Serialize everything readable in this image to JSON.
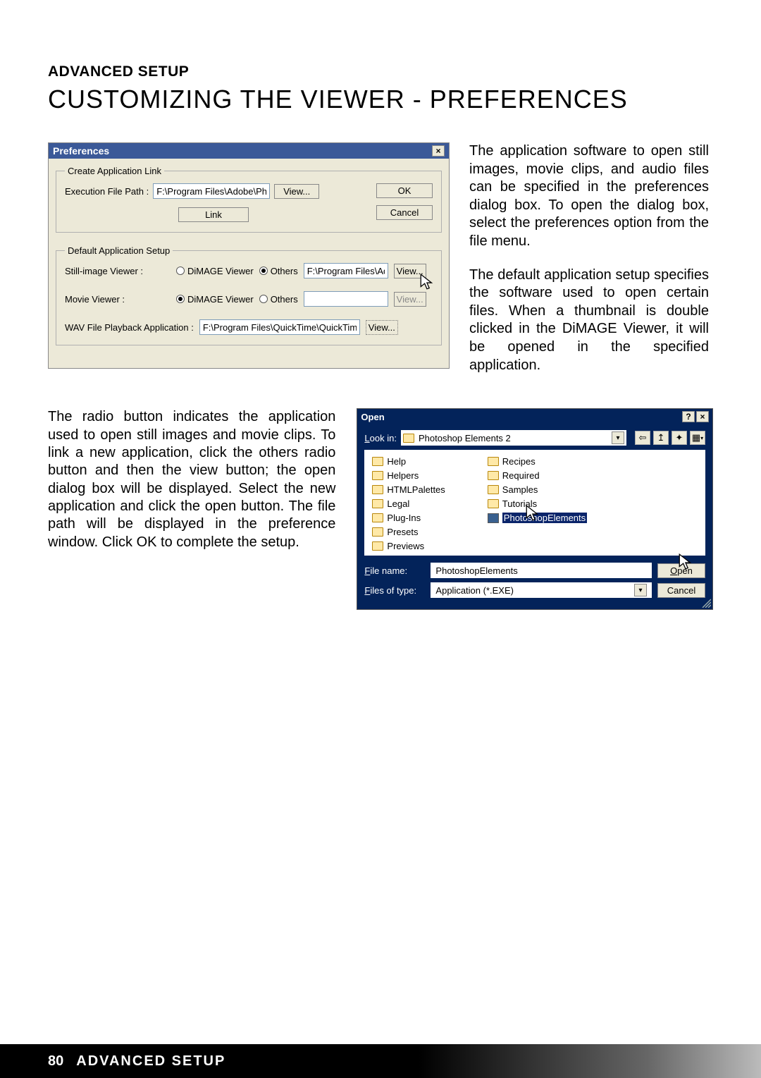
{
  "header": {
    "section_label": "ADVANCED SETUP",
    "page_title": "CUSTOMIZING THE VIEWER - PREFERENCES"
  },
  "prefs": {
    "title": "Preferences",
    "close_glyph": "×",
    "create_link_legend": "Create Application Link",
    "exec_label": "Execution File Path :",
    "exec_value": "F:\\Program Files\\Adobe\\Photo",
    "view_btn": "View...",
    "ok_btn": "OK",
    "cancel_btn": "Cancel",
    "link_btn": "Link",
    "default_legend": "Default Application Setup",
    "still_label": "Still-image Viewer :",
    "dimage_label": "DiMAGE Viewer",
    "others_label": "Others",
    "still_others_value": "F:\\Program Files\\Adobe",
    "movie_label": "Movie Viewer :",
    "wav_label": "WAV File Playback Application :",
    "wav_value": "F:\\Program Files\\QuickTime\\QuickTimePlay",
    "view_btn_dotted": "View..."
  },
  "text": {
    "right1": "The application software to open still images, movie clips, and audio files can be specified in the preferences dialog box. To open the dialog box, select the preferences option from the file menu.",
    "right2": "The default application setup specifies the software used to open certain files. When a thumbnail is double clicked in the DiMAGE Viewer, it will be opened in the specified application.",
    "left": "The radio button indicates the application used to open still images and movie clips. To link a new application, click the others radio button and then the view button; the open dialog box will be displayed. Select the new application and click the open button. The file path will be displayed in the preference window. Click OK to complete the setup."
  },
  "open": {
    "title": "Open",
    "help_glyph": "?",
    "close_glyph": "×",
    "lookin_label": "Look in:",
    "lookin_value": "Photoshop Elements 2",
    "back_glyph": "⇦",
    "up_glyph": "↥",
    "new_glyph": "✦",
    "view_glyph": "▦",
    "drop_glyph": "▾",
    "folders_left": [
      "Help",
      "Helpers",
      "HTMLPalettes",
      "Legal",
      "Plug-Ins",
      "Presets",
      "Previews"
    ],
    "folders_right_plain": [
      "Recipes",
      "Required",
      "Samples",
      "Tutorials"
    ],
    "selected_exe": "PhotoshopElements",
    "filename_label": "File name:",
    "filename_value": "PhotoshopElements",
    "filetype_label": "Files of type:",
    "filetype_value": "Application (*.EXE)",
    "open_btn": "Open",
    "cancel_btn": "Cancel"
  },
  "footer": {
    "page_num": "80",
    "section": "ADVANCED SETUP"
  }
}
